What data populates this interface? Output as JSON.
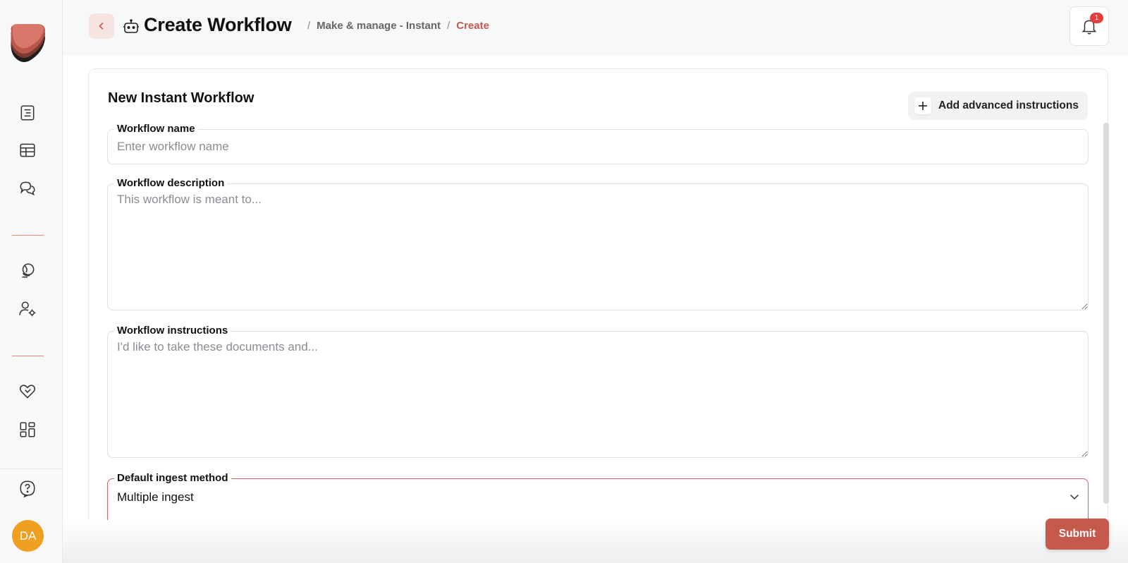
{
  "header": {
    "title": "Create Workflow",
    "breadcrumb": {
      "separator": "/",
      "parent": "Make & manage - Instant",
      "current": "Create"
    },
    "notifications_count": "1"
  },
  "sidebar": {
    "items": [
      {
        "name": "document-list",
        "icon": "document-list-icon"
      },
      {
        "name": "table",
        "icon": "table-icon"
      },
      {
        "name": "chat",
        "icon": "chat-icon"
      },
      {
        "name": "explore",
        "icon": "globe-pin-icon"
      },
      {
        "name": "user-settings",
        "icon": "user-gear-icon"
      },
      {
        "name": "favorites",
        "icon": "heart-hand-icon"
      },
      {
        "name": "apps",
        "icon": "grid-apps-icon"
      },
      {
        "name": "help",
        "icon": "help-icon"
      }
    ],
    "avatar_initials": "DA"
  },
  "form": {
    "title": "New Instant Workflow",
    "advanced_button": "Add advanced instructions",
    "name_field": {
      "label": "Workflow name",
      "placeholder": "Enter workflow name",
      "value": ""
    },
    "description_field": {
      "label": "Workflow description",
      "placeholder": "This workflow is meant to...",
      "value": ""
    },
    "instructions_field": {
      "label": "Workflow instructions",
      "placeholder": "I'd like to take these documents and...",
      "value": ""
    },
    "ingest_field": {
      "label": "Default ingest method",
      "value": "Multiple ingest"
    },
    "submit_label": "Submit"
  },
  "colors": {
    "accent": "#c55a4c",
    "accent_soft": "#f6e4e1",
    "avatar": "#f0a020",
    "badge": "#e53e3e"
  }
}
